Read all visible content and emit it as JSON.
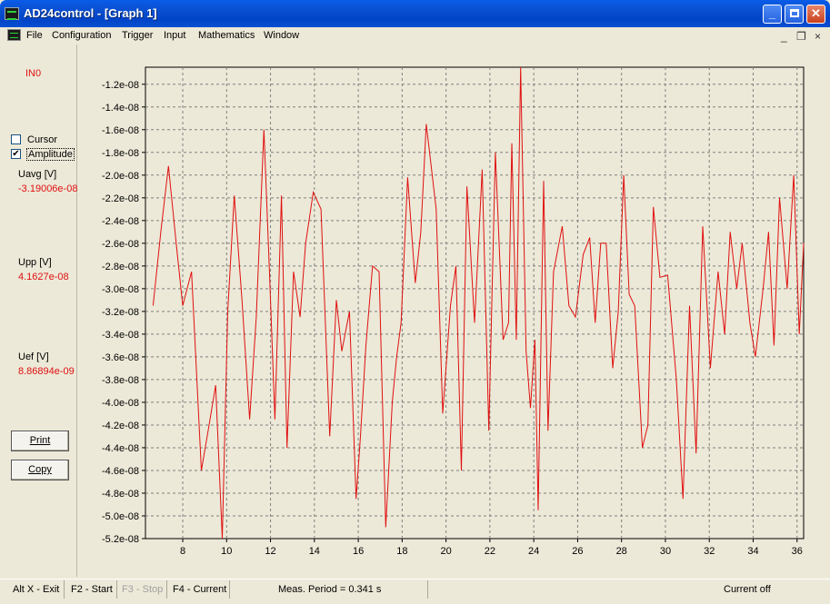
{
  "window": {
    "title": "AD24control - [Graph 1]",
    "min": "_",
    "max": "□",
    "close": "✕"
  },
  "menu": [
    "File",
    "Configuration",
    "Trigger",
    "Input",
    "Mathematics",
    "Window"
  ],
  "mdi": {
    "min": "_",
    "restore": "❐",
    "close": "×"
  },
  "panel": {
    "channel": "IN0",
    "cursor_label": "Cursor",
    "cursor_checked": false,
    "amplitude_label": "Amplitude",
    "amplitude_checked": true,
    "uavg_label": "Uavg [V]",
    "uavg_value": "-3.19006e-08",
    "upp_label": "Upp [V]",
    "upp_value": "4.1627e-08",
    "uef_label": "Uef [V]",
    "uef_value": "8.86894e-09",
    "print_label": "Print",
    "copy_label": "Copy"
  },
  "status": {
    "exit": "Alt X - Exit",
    "start": "F2 - Start",
    "stop": "F3 - Stop",
    "current": "F4 - Current",
    "period": "Meas. Period = 0.341 s",
    "current_state": "Current off"
  },
  "colors": {
    "trace": "#e01010",
    "grid": "#808080",
    "disabled_text": "#a0a0a0"
  },
  "chart_data": {
    "type": "line",
    "grid": true,
    "xlim": [
      6.3,
      36.3
    ],
    "ylim": [
      -5.2e-08,
      -1.05e-08
    ],
    "xticks": [
      "8",
      "10",
      "12",
      "14",
      "16",
      "18",
      "20",
      "22",
      "24",
      "26",
      "28",
      "30",
      "32",
      "34",
      "36"
    ],
    "yticks": [
      "-1.2e-08",
      "-1.4e-08",
      "-1.6e-08",
      "-1.8e-08",
      "-2.0e-08",
      "-2.2e-08",
      "-2.4e-08",
      "-2.6e-08",
      "-2.8e-08",
      "-3.0e-08",
      "-3.2e-08",
      "-3.4e-08",
      "-3.6e-08",
      "-3.8e-08",
      "-4.0e-08",
      "-4.2e-08",
      "-4.4e-08",
      "-4.6e-08",
      "-4.8e-08",
      "-5.0e-08",
      "-5.2e-08"
    ],
    "series": [
      {
        "x": [
          6.65,
          7.0,
          7.35,
          7.7,
          8.0,
          8.4,
          8.85,
          9.2,
          9.5,
          9.8,
          10.05,
          10.35,
          10.7,
          11.05,
          11.35,
          11.7,
          11.95,
          12.2,
          12.5,
          12.75,
          13.05,
          13.35,
          13.6,
          13.95,
          14.3,
          14.7,
          15.0,
          15.25,
          15.6,
          15.9,
          16.1,
          16.35,
          16.65,
          16.95,
          17.25,
          17.55,
          17.75,
          17.95,
          18.25,
          18.6,
          18.85,
          19.1,
          19.55,
          19.85,
          20.2,
          20.45,
          20.7,
          20.95,
          21.3,
          21.65,
          21.95,
          22.25,
          22.6,
          22.85,
          23.0,
          23.2,
          23.4,
          23.65,
          23.85,
          24.05,
          24.2,
          24.45,
          24.65,
          24.9,
          25.3,
          25.6,
          25.9,
          26.25,
          26.55,
          26.8,
          27.05,
          27.3,
          27.6,
          27.85,
          28.1,
          28.35,
          28.6,
          28.95,
          29.2,
          29.45,
          29.75,
          30.1,
          30.5,
          30.8,
          31.1,
          31.4,
          31.7,
          32.05,
          32.4,
          32.7,
          32.95,
          33.25,
          33.5,
          33.85,
          34.1,
          34.45,
          34.7,
          34.95,
          35.2,
          35.55,
          35.85,
          36.1,
          36.3
        ],
        "y": [
          -3.15e-08,
          -2.5e-08,
          -1.92e-08,
          -2.6e-08,
          -3.15e-08,
          -2.85e-08,
          -4.6e-08,
          -4.2e-08,
          -3.85e-08,
          -5.2e-08,
          -3.2e-08,
          -2.18e-08,
          -3.1e-08,
          -4.15e-08,
          -3.25e-08,
          -1.6e-08,
          -2.85e-08,
          -4.15e-08,
          -2.18e-08,
          -4.4e-08,
          -2.85e-08,
          -3.25e-08,
          -2.6e-08,
          -2.15e-08,
          -2.3e-08,
          -4.3e-08,
          -3.1e-08,
          -3.55e-08,
          -3.2e-08,
          -4.85e-08,
          -4.3e-08,
          -3.5e-08,
          -2.8e-08,
          -2.85e-08,
          -5.1e-08,
          -4e-08,
          -3.6e-08,
          -3.3e-08,
          -2.02e-08,
          -2.95e-08,
          -2.5e-08,
          -1.55e-08,
          -2.3e-08,
          -4.1e-08,
          -3.15e-08,
          -2.8e-08,
          -4.6e-08,
          -2.1e-08,
          -3.3e-08,
          -1.95e-08,
          -4.25e-08,
          -1.8e-08,
          -3.45e-08,
          -3.3e-08,
          -1.72e-08,
          -3.45e-08,
          -1e-08,
          -3.55e-08,
          -4.05e-08,
          -3.45e-08,
          -4.95e-08,
          -2.05e-08,
          -4.25e-08,
          -2.85e-08,
          -2.45e-08,
          -3.15e-08,
          -3.25e-08,
          -2.7e-08,
          -2.55e-08,
          -3.3e-08,
          -2.6e-08,
          -2.6e-08,
          -3.7e-08,
          -3.2e-08,
          -2e-08,
          -3.05e-08,
          -3.15e-08,
          -4.4e-08,
          -4.2e-08,
          -2.28e-08,
          -2.9e-08,
          -2.88e-08,
          -3.8e-08,
          -4.85e-08,
          -3.15e-08,
          -4.45e-08,
          -2.45e-08,
          -3.7e-08,
          -2.85e-08,
          -3.4e-08,
          -2.5e-08,
          -3e-08,
          -2.6e-08,
          -3.3e-08,
          -3.6e-08,
          -3e-08,
          -2.5e-08,
          -3.5e-08,
          -2.2e-08,
          -3e-08,
          -2e-08,
          -3.4e-08,
          -2.6e-08
        ]
      }
    ]
  }
}
